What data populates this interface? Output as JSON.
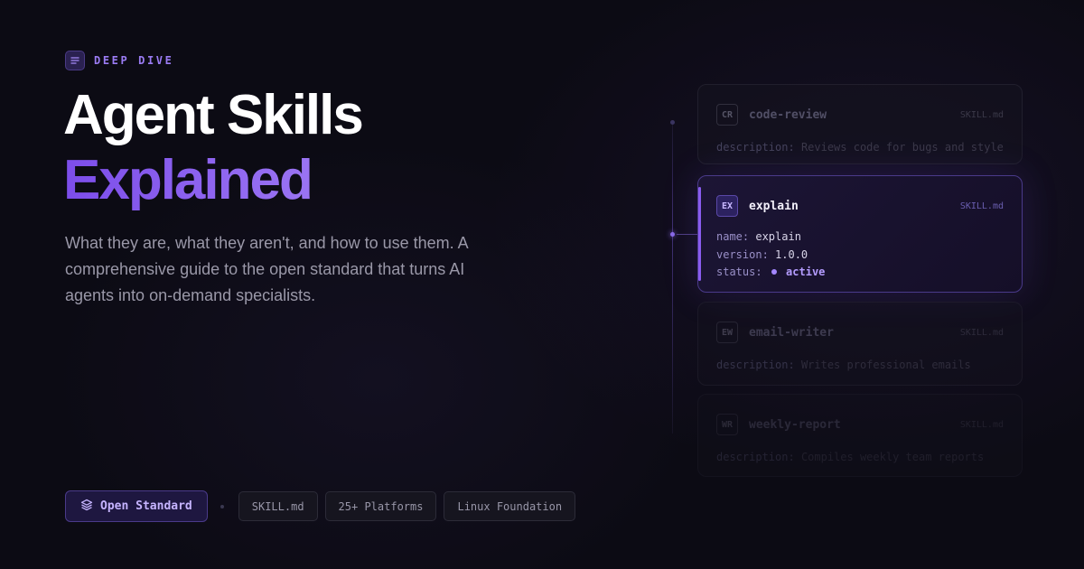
{
  "eyebrow": {
    "icon": "document-lines-icon",
    "label": "DEEP DIVE"
  },
  "title": {
    "line1": "Agent Skills",
    "line2": "Explained"
  },
  "subtitle": "What they are, what they aren't, and how to use them. A comprehensive guide to the open standard that turns AI agents into on-demand specialists.",
  "tags": {
    "primary": {
      "icon": "layers-icon",
      "label": "Open Standard"
    },
    "items": [
      "SKILL.md",
      "25+ Platforms",
      "Linux Foundation"
    ]
  },
  "skills": [
    {
      "badge": "CR",
      "name": "code-review",
      "file": "SKILL.md",
      "desc_key": "description:",
      "desc": "Reviews code for bugs and style"
    },
    {
      "badge": "EX",
      "name": "explain",
      "file": "SKILL.md",
      "fields": {
        "name_key": "name:",
        "name": "explain",
        "version_key": "version:",
        "version": "1.0.0",
        "status_key": "status:",
        "status": "active"
      }
    },
    {
      "badge": "EW",
      "name": "email-writer",
      "file": "SKILL.md",
      "desc_key": "description:",
      "desc": "Writes professional emails"
    },
    {
      "badge": "WR",
      "name": "weekly-report",
      "file": "SKILL.md",
      "desc_key": "description:",
      "desc": "Compiles weekly team reports"
    }
  ],
  "colors": {
    "accent": "#8a5cf0",
    "background": "#0c0b14",
    "title": "#ffffff",
    "title_gradient_start": "#7c4dea",
    "title_gradient_end": "#a07cf5"
  }
}
